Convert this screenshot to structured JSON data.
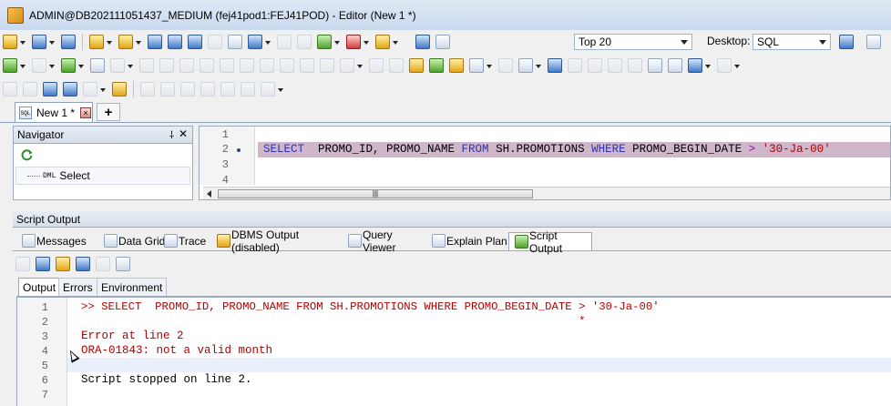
{
  "window": {
    "title": "ADMIN@DB202111051437_MEDIUM (fej41pod1:FEJ41POD) - Editor (New 1 *)"
  },
  "toolbar": {
    "top_rows_label": "Top 20",
    "desktop_label": "Desktop:",
    "desktop_value": "SQL"
  },
  "doc_tabs": {
    "active_label": "New 1 *",
    "sql_icon_text": "SQL",
    "add_label": "+"
  },
  "navigator": {
    "title": "Navigator",
    "item_prefix": "DML",
    "item_label": "Select",
    "pin_glyph": "⸸",
    "close_glyph": "✕"
  },
  "editor": {
    "line_numbers": [
      "1",
      "2",
      "3",
      "4"
    ],
    "line2": {
      "select": "SELECT",
      "cols": "  PROMO_ID, PROMO_NAME ",
      "from": "FROM",
      "table": " SH.PROMOTIONS ",
      "where": "WHERE",
      "cond_col": " PROMO_BEGIN_DATE ",
      "op": ">",
      "space": " ",
      "literal": "'30-Ja-00'"
    },
    "scroll_thumb_glyph": "|||"
  },
  "script_output": {
    "title": "Script Output",
    "tabs": [
      "Messages",
      "Data Grid",
      "Trace",
      "DBMS Output (disabled)",
      "Query Viewer",
      "Explain Plan",
      "Script Output"
    ],
    "output_tabs": [
      "Output",
      "Errors",
      "Environment"
    ],
    "line_numbers": [
      "1",
      "2",
      "3",
      "4",
      "5",
      "6",
      "7"
    ],
    "lines": [
      ">> SELECT  PROMO_ID, PROMO_NAME FROM SH.PROMOTIONS WHERE PROMO_BEGIN_DATE > '30-Ja-00'",
      "                                                                          *",
      "Error at line 2",
      "ORA-01843: not a valid month",
      "",
      "Script stopped on line 2.",
      ""
    ]
  },
  "colors": {
    "keyword": "#3232b4",
    "string": "#b40000",
    "operator": "#b400b4",
    "error_text": "#b40000",
    "line_highlight": "#cfb6c9"
  }
}
